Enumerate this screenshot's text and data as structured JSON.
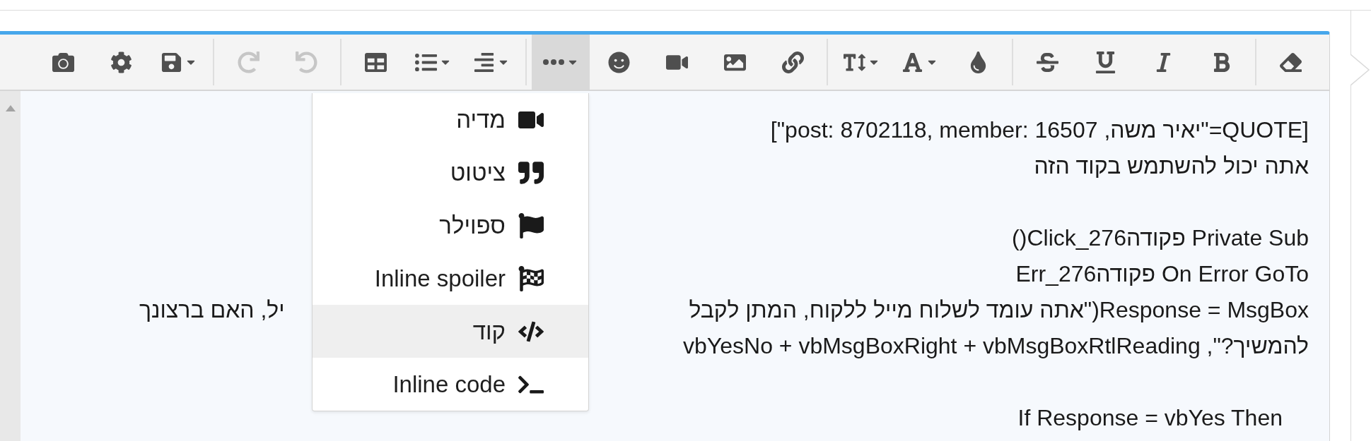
{
  "toolbar": {
    "groups": [
      {
        "buttons": [
          {
            "kind": "camera",
            "disabled": false,
            "pressed": false,
            "menu": false
          },
          {
            "kind": "gear",
            "disabled": false,
            "pressed": false,
            "menu": false
          },
          {
            "kind": "save",
            "disabled": false,
            "pressed": false,
            "menu": true
          }
        ]
      },
      {
        "buttons": [
          {
            "kind": "redo",
            "disabled": true,
            "pressed": false,
            "menu": false
          },
          {
            "kind": "undo",
            "disabled": true,
            "pressed": false,
            "menu": false
          }
        ]
      },
      {
        "buttons": [
          {
            "kind": "table",
            "disabled": false,
            "pressed": false,
            "menu": false
          },
          {
            "kind": "list",
            "disabled": false,
            "pressed": false,
            "menu": true
          },
          {
            "kind": "align",
            "disabled": false,
            "pressed": false,
            "menu": true
          }
        ]
      },
      {
        "buttons": [
          {
            "kind": "more",
            "disabled": false,
            "pressed": true,
            "menu": true
          },
          {
            "kind": "smiley",
            "disabled": false,
            "pressed": false,
            "menu": false
          },
          {
            "kind": "video",
            "disabled": false,
            "pressed": false,
            "menu": false
          },
          {
            "kind": "image",
            "disabled": false,
            "pressed": false,
            "menu": false
          },
          {
            "kind": "link",
            "disabled": false,
            "pressed": false,
            "menu": false
          }
        ]
      },
      {
        "buttons": [
          {
            "kind": "textsize",
            "disabled": false,
            "pressed": false,
            "menu": true
          },
          {
            "kind": "font",
            "disabled": false,
            "pressed": false,
            "menu": true
          },
          {
            "kind": "drop",
            "disabled": false,
            "pressed": false,
            "menu": false
          }
        ]
      },
      {
        "buttons": [
          {
            "kind": "strike",
            "disabled": false,
            "pressed": false,
            "menu": false
          },
          {
            "kind": "underline",
            "disabled": false,
            "pressed": false,
            "menu": false
          },
          {
            "kind": "italic",
            "disabled": false,
            "pressed": false,
            "menu": false
          },
          {
            "kind": "bold",
            "disabled": false,
            "pressed": false,
            "menu": false
          }
        ]
      },
      {
        "buttons": [
          {
            "kind": "eraser",
            "disabled": false,
            "pressed": false,
            "menu": false
          }
        ]
      }
    ]
  },
  "editor": {
    "lines": [
      {
        "kind": "text",
        "text": "[QUOTE=\"יאיר משה, post: 8702118, member: 16507\"]"
      },
      {
        "kind": "text",
        "text": "אתה יכול להשתמש בקוד הזה"
      },
      {
        "kind": "blank"
      },
      {
        "kind": "text",
        "text": "Private Sub פקודהClick_276()"
      },
      {
        "kind": "text",
        "text": "On Error GoTo פקודהErr_276"
      },
      {
        "kind": "split",
        "right": "Response = MsgBox(\"אתה עומד לשלוח מייל ללקוח, המתן לקבל",
        "left": "יל, האם ברצונך"
      },
      {
        "kind": "text",
        "text": "להמשיך?\", vbYesNo + vbMsgBoxRight + vbMsgBoxRtlReading"
      },
      {
        "kind": "blank"
      },
      {
        "kind": "indented",
        "text": "If Response = vbYes Then"
      }
    ]
  },
  "insert_menu": {
    "items": [
      {
        "kind": "video",
        "label": "מדיה",
        "selected": false
      },
      {
        "kind": "quote",
        "label": "ציטוט",
        "selected": false
      },
      {
        "kind": "flag",
        "label": "ספוילר",
        "selected": false
      },
      {
        "kind": "checkered",
        "label": "Inline spoiler",
        "selected": false
      },
      {
        "kind": "code",
        "label": "קוד",
        "selected": true
      },
      {
        "kind": "terminal",
        "label": "Inline code",
        "selected": false
      }
    ]
  }
}
